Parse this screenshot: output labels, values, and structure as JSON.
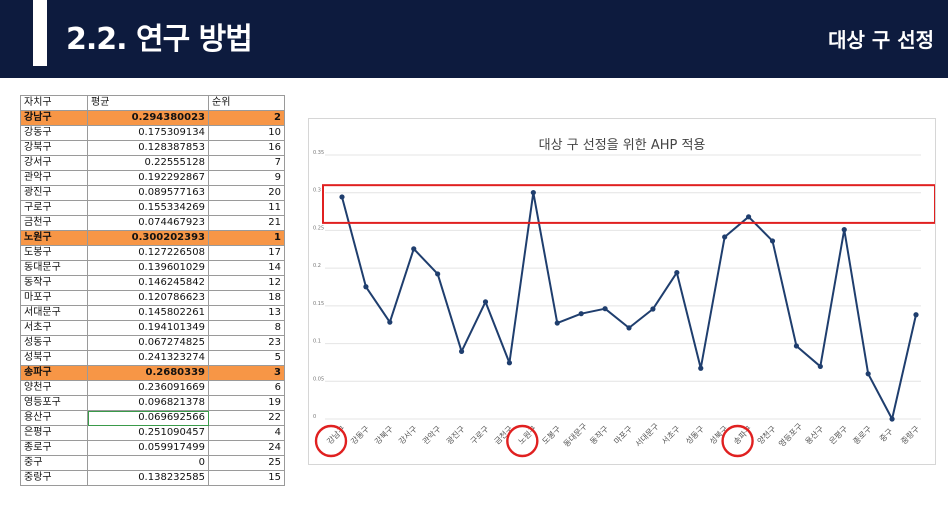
{
  "header": {
    "title": "2.2. 연구 방법",
    "subtitle": "대상 구 선정"
  },
  "colors": {
    "header_bg": "#0d1b3e",
    "highlight_row": "#f79646",
    "line": "#1f3e6e",
    "red_marker": "#e02020"
  },
  "table": {
    "columns": [
      "자치구",
      "평균",
      "순위"
    ],
    "rows": [
      {
        "name": "강남구",
        "avg": "0.294380023",
        "rank": "2",
        "highlight": true
      },
      {
        "name": "강동구",
        "avg": "0.175309134",
        "rank": "10"
      },
      {
        "name": "강북구",
        "avg": "0.128387853",
        "rank": "16"
      },
      {
        "name": "강서구",
        "avg": "0.22555128",
        "rank": "7"
      },
      {
        "name": "관악구",
        "avg": "0.192292867",
        "rank": "9"
      },
      {
        "name": "광진구",
        "avg": "0.089577163",
        "rank": "20"
      },
      {
        "name": "구로구",
        "avg": "0.155334269",
        "rank": "11"
      },
      {
        "name": "금천구",
        "avg": "0.074467923",
        "rank": "21"
      },
      {
        "name": "노원구",
        "avg": "0.300202393",
        "rank": "1",
        "highlight": true
      },
      {
        "name": "도봉구",
        "avg": "0.127226508",
        "rank": "17"
      },
      {
        "name": "동대문구",
        "avg": "0.139601029",
        "rank": "14"
      },
      {
        "name": "동작구",
        "avg": "0.146245842",
        "rank": "12"
      },
      {
        "name": "마포구",
        "avg": "0.120786623",
        "rank": "18"
      },
      {
        "name": "서대문구",
        "avg": "0.145802261",
        "rank": "13"
      },
      {
        "name": "서초구",
        "avg": "0.194101349",
        "rank": "8"
      },
      {
        "name": "성동구",
        "avg": "0.067274825",
        "rank": "23"
      },
      {
        "name": "성북구",
        "avg": "0.241323274",
        "rank": "5"
      },
      {
        "name": "송파구",
        "avg": "0.2680339",
        "rank": "3",
        "highlight": true
      },
      {
        "name": "양천구",
        "avg": "0.236091669",
        "rank": "6"
      },
      {
        "name": "영등포구",
        "avg": "0.096821378",
        "rank": "19"
      },
      {
        "name": "용산구",
        "avg": "0.069692566",
        "rank": "22",
        "selected": true
      },
      {
        "name": "은평구",
        "avg": "0.251090457",
        "rank": "4"
      },
      {
        "name": "종로구",
        "avg": "0.059917499",
        "rank": "24"
      },
      {
        "name": "중구",
        "avg": "0",
        "rank": "25"
      },
      {
        "name": "중랑구",
        "avg": "0.138232585",
        "rank": "15"
      }
    ]
  },
  "chart_data": {
    "type": "line",
    "title": "대상 구 선정을 위한 AHP 적용",
    "categories": [
      "강남구",
      "강동구",
      "강북구",
      "강서구",
      "관악구",
      "광진구",
      "구로구",
      "금천구",
      "노원구",
      "도봉구",
      "동대문구",
      "동작구",
      "마포구",
      "서대문구",
      "서초구",
      "성동구",
      "성북구",
      "송파구",
      "양천구",
      "영등포구",
      "용산구",
      "은평구",
      "종로구",
      "중구",
      "중랑구"
    ],
    "values": [
      0.294380023,
      0.175309134,
      0.128387853,
      0.22555128,
      0.192292867,
      0.089577163,
      0.155334269,
      0.074467923,
      0.300202393,
      0.127226508,
      0.139601029,
      0.146245842,
      0.120786623,
      0.145802261,
      0.194101349,
      0.067274825,
      0.241323274,
      0.2680339,
      0.236091669,
      0.096821378,
      0.069692566,
      0.251090457,
      0.059917499,
      0,
      0.138232585
    ],
    "yticks": [
      "0",
      "0.05",
      "0.1",
      "0.15",
      "0.2",
      "0.25",
      "0.3",
      "0.35"
    ],
    "ylim": [
      0,
      0.35
    ],
    "grid": true,
    "legend": "none",
    "highlight_band": [
      0.26,
      0.31
    ],
    "circled_categories": [
      "강남구",
      "노원구",
      "송파구"
    ]
  }
}
